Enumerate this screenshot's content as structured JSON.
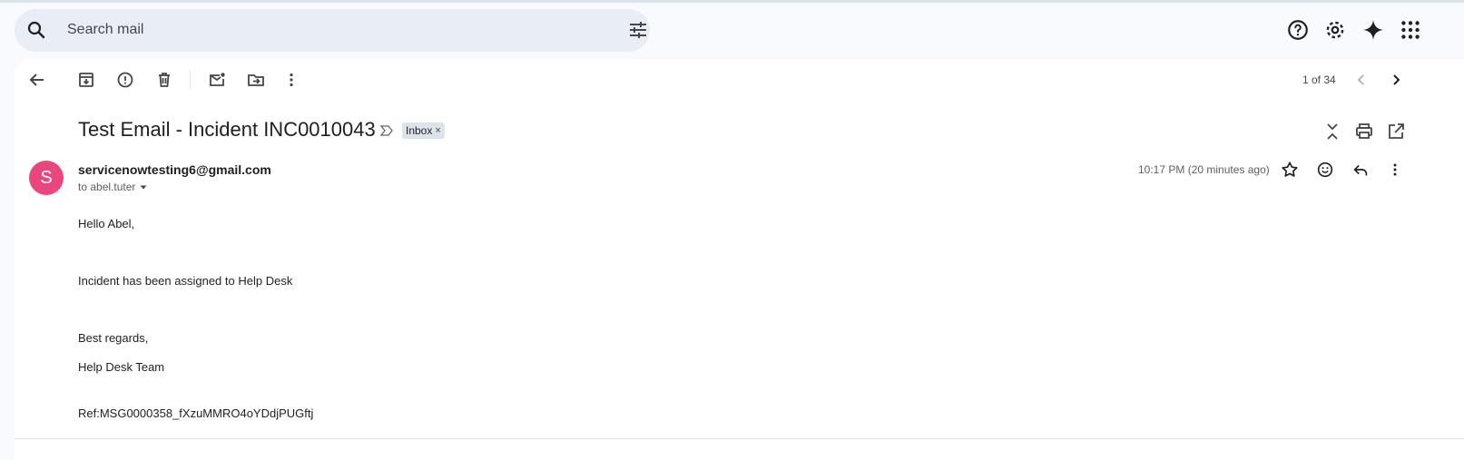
{
  "search": {
    "placeholder": "Search mail"
  },
  "header_icons": [
    "help-icon",
    "settings-icon",
    "gemini-sparkle-icon",
    "apps-grid-icon"
  ],
  "toolbar": {
    "icons": [
      "back-arrow-icon",
      "archive-icon",
      "report-spam-icon",
      "delete-icon",
      "mark-unread-icon",
      "move-to-icon",
      "more-vert-icon"
    ],
    "page_count": "1 of 34"
  },
  "email": {
    "subject": "Test Email - Incident INC0010043",
    "label": "Inbox",
    "label_close": "×",
    "avatar_letter": "S",
    "avatar_color": "#e8467c",
    "sender": "servicenowtesting6@gmail.com",
    "to": "to abel.tuter",
    "timestamp": "10:17 PM (20 minutes ago)",
    "body": {
      "greeting": "Hello Abel,",
      "line1": "Incident has been assigned to Help Desk",
      "closing": "Best regards,",
      "signature": "Help Desk Team",
      "ref": "Ref:MSG0000358_fXzuMMRO4oYDdjPUGftj"
    }
  }
}
